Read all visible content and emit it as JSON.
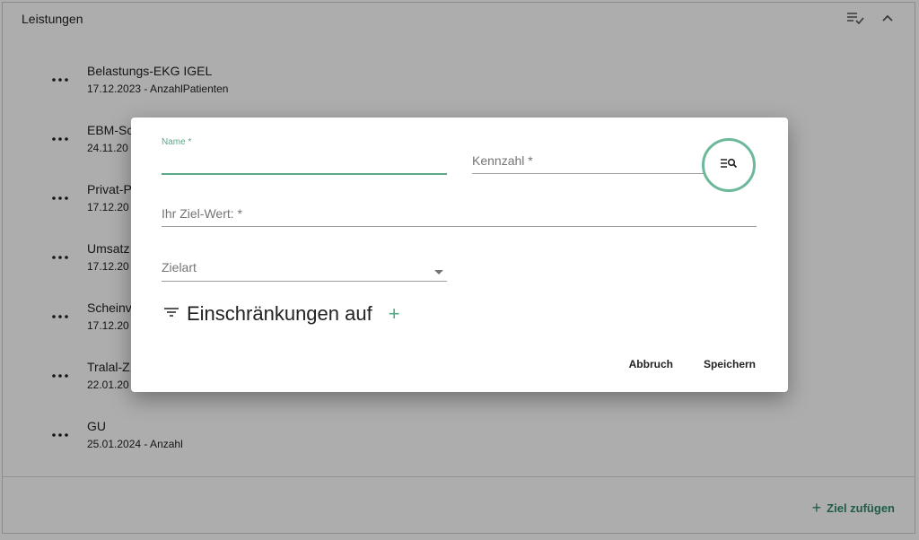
{
  "panel": {
    "title": "Leistungen",
    "items": [
      {
        "name": "Belastungs-EKG IGEL",
        "sub": "17.12.2023 - AnzahlPatienten"
      },
      {
        "name": "EBM-Sc",
        "sub": "24.11.20"
      },
      {
        "name": "Privat-P",
        "sub": "17.12.20"
      },
      {
        "name": "Umsatz",
        "sub": "17.12.20"
      },
      {
        "name": "Scheinv",
        "sub": "17.12.20"
      },
      {
        "name": "Tralal-Z",
        "sub": "22.01.20"
      },
      {
        "name": "GU",
        "sub": "25.01.2024 - Anzahl"
      }
    ],
    "add_goal_label": "Ziel zufügen"
  },
  "dialog": {
    "name_label": "Name *",
    "name_value": "",
    "kennzahl_label": "Kennzahl *",
    "ziel_wert_label": "Ihr Ziel-Wert: *",
    "zielart_label": "Zielart",
    "restrictions_label": "Einschränkungen auf",
    "cancel_label": "Abbruch",
    "save_label": "Speichern"
  },
  "colors": {
    "accent": "#5aa887",
    "add_goal": "#2f8a6a",
    "overlay": "rgba(0,0,0,0.32)"
  },
  "icons": {
    "panel_filter": "list-check-icon",
    "panel_collapse": "chevron-up-icon",
    "item_menu": "more-horizontal-icon",
    "search": "list-search-icon",
    "filter": "filter-lines-icon",
    "add": "plus-icon"
  }
}
